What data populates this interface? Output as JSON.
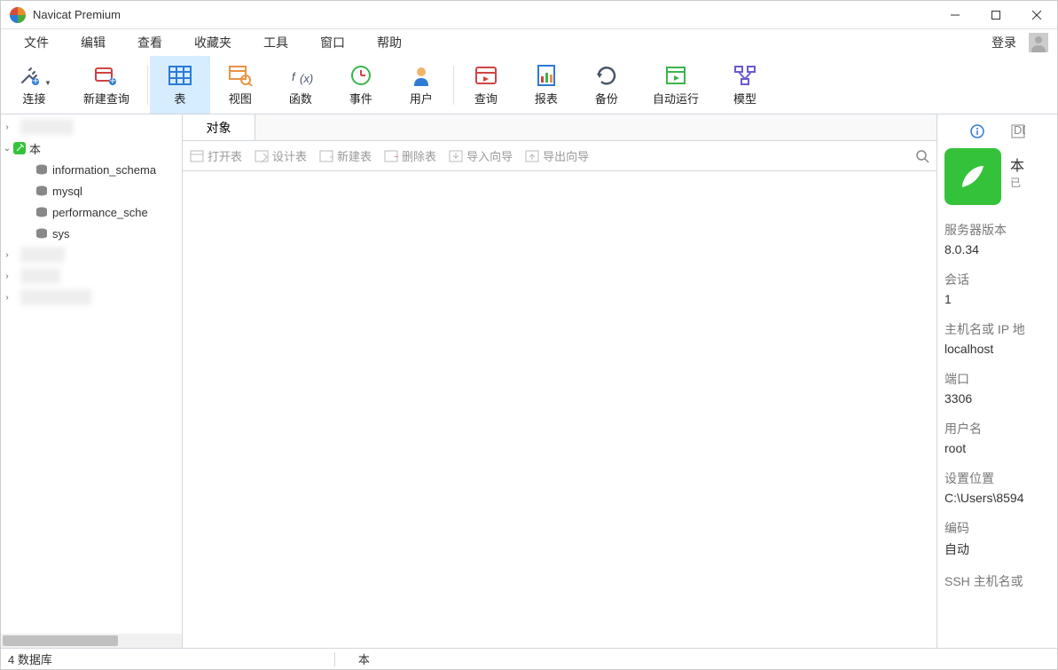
{
  "window": {
    "title": "Navicat Premium"
  },
  "menu": {
    "items": [
      "文件",
      "编辑",
      "查看",
      "收藏夹",
      "工具",
      "窗口",
      "帮助"
    ],
    "login": "登录"
  },
  "toolbar": {
    "connect": "连接",
    "newquery": "新建查询",
    "table": "表",
    "view": "视图",
    "function": "函数",
    "event": "事件",
    "user": "用户",
    "query": "查询",
    "report": "报表",
    "backup": "备份",
    "autorun": "自动运行",
    "model": "模型"
  },
  "tree": {
    "active_conn": "本",
    "databases": [
      "information_schema",
      "mysql",
      "performance_sche",
      "sys"
    ]
  },
  "tabs": {
    "objects": "对象"
  },
  "subtoolbar": {
    "open": "打开表",
    "design": "设计表",
    "new": "新建表",
    "delete": "删除表",
    "import": "导入向导",
    "export": "导出向导"
  },
  "info": {
    "conn_name": "本",
    "conn_status": "已",
    "server_version_label": "服务器版本",
    "server_version": "8.0.34",
    "sessions_label": "会话",
    "sessions": "1",
    "host_label": "主机名或 IP 地",
    "host": "localhost",
    "port_label": "端口",
    "port": "3306",
    "user_label": "用户名",
    "user": "root",
    "settings_label": "设置位置",
    "settings": "C:\\Users\\8594",
    "encoding_label": "编码",
    "encoding": "自动",
    "ssh_label": "SSH 主机名或"
  },
  "status": {
    "left": "4 数据库",
    "path": "本"
  }
}
